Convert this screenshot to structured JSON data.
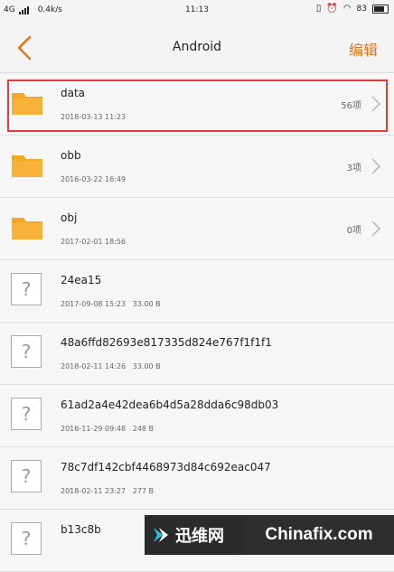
{
  "status_bar": {
    "network": "4G",
    "speed": "0.4k/s",
    "time": "11:13",
    "battery": "83"
  },
  "header": {
    "title": "Android",
    "edit_label": "编辑"
  },
  "items": [
    {
      "name": "data",
      "date": "2018-03-13 11:23",
      "size": "",
      "count": "56项",
      "type": "folder",
      "highlighted": true
    },
    {
      "name": "obb",
      "date": "2016-03-22 16:49",
      "size": "",
      "count": "3项",
      "type": "folder"
    },
    {
      "name": "obj",
      "date": "2017-02-01 18:56",
      "size": "",
      "count": "0项",
      "type": "folder"
    },
    {
      "name": "24ea15",
      "date": "2017-09-08 15:23",
      "size": "33.00 B",
      "count": "",
      "type": "unknown"
    },
    {
      "name": "48a6ffd82693e817335d824e767f1f1f1",
      "date": "2018-02-11 14:26",
      "size": "33.00 B",
      "count": "",
      "type": "unknown"
    },
    {
      "name": "61ad2a4e42dea6b4d5a28dda6c98db03",
      "date": "2016-11-29 09:48",
      "size": "248 B",
      "count": "",
      "type": "unknown"
    },
    {
      "name": "78c7df142cbf4468973d84c692eac047",
      "date": "2018-02-11 23:27",
      "size": "277 B",
      "count": "",
      "type": "unknown"
    },
    {
      "name": "b13c8b",
      "date": "",
      "size": "",
      "count": "",
      "type": "unknown"
    }
  ],
  "watermark": {
    "left_text": "迅维网",
    "right_text": "Chinafix.com"
  },
  "colors": {
    "accent": "#e3741a",
    "folder": "#f5a623",
    "highlight": "#e23b3b"
  }
}
